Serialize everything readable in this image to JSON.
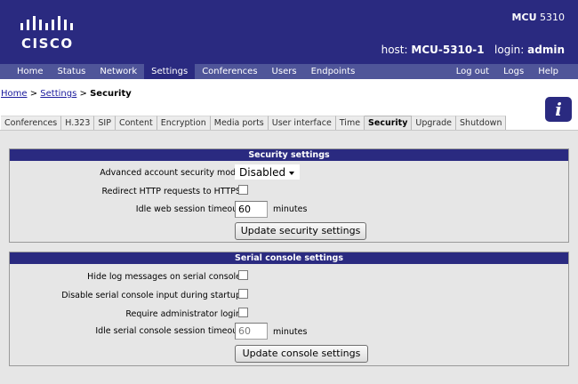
{
  "header": {
    "logo_text": "CISCO",
    "product_prefix": "MCU",
    "product_model": "5310",
    "host_label": "host:",
    "host_value": "MCU-5310-1",
    "login_label": "login:",
    "login_value": "admin"
  },
  "nav": {
    "left": [
      "Home",
      "Status",
      "Network",
      "Settings",
      "Conferences",
      "Users",
      "Endpoints"
    ],
    "active": "Settings",
    "right": [
      "Log out",
      "Logs",
      "Help"
    ]
  },
  "breadcrumb": {
    "home": "Home",
    "sep1": ">",
    "settings": "Settings",
    "sep2": ">",
    "current": "Security"
  },
  "info_icon": "info-icon",
  "tabs": {
    "items": [
      "Conferences",
      "H.323",
      "SIP",
      "Content",
      "Encryption",
      "Media ports",
      "User interface",
      "Time",
      "Security",
      "Upgrade",
      "Shutdown"
    ],
    "active": "Security"
  },
  "security": {
    "title": "Security settings",
    "account_mode_label": "Advanced account security mode",
    "account_mode_value": "Disabled",
    "redirect_label": "Redirect HTTP requests to HTTPS",
    "redirect_checked": false,
    "timeout_label": "Idle web session timeout",
    "timeout_value": "60",
    "timeout_unit": "minutes",
    "update_label": "Update security settings"
  },
  "console": {
    "title": "Serial console settings",
    "hide_log_label": "Hide log messages on serial console",
    "hide_log_checked": false,
    "disable_input_label": "Disable serial console input during startup",
    "disable_input_checked": false,
    "require_login_label": "Require administrator login",
    "require_login_checked": false,
    "timeout_label": "Idle serial console session timeout",
    "timeout_value": "60",
    "timeout_unit": "minutes",
    "update_label": "Update console settings"
  },
  "colors": {
    "header_bg": "#2a2a80",
    "nav_bg": "#4f5599",
    "content_bg": "#e6e6e6"
  }
}
